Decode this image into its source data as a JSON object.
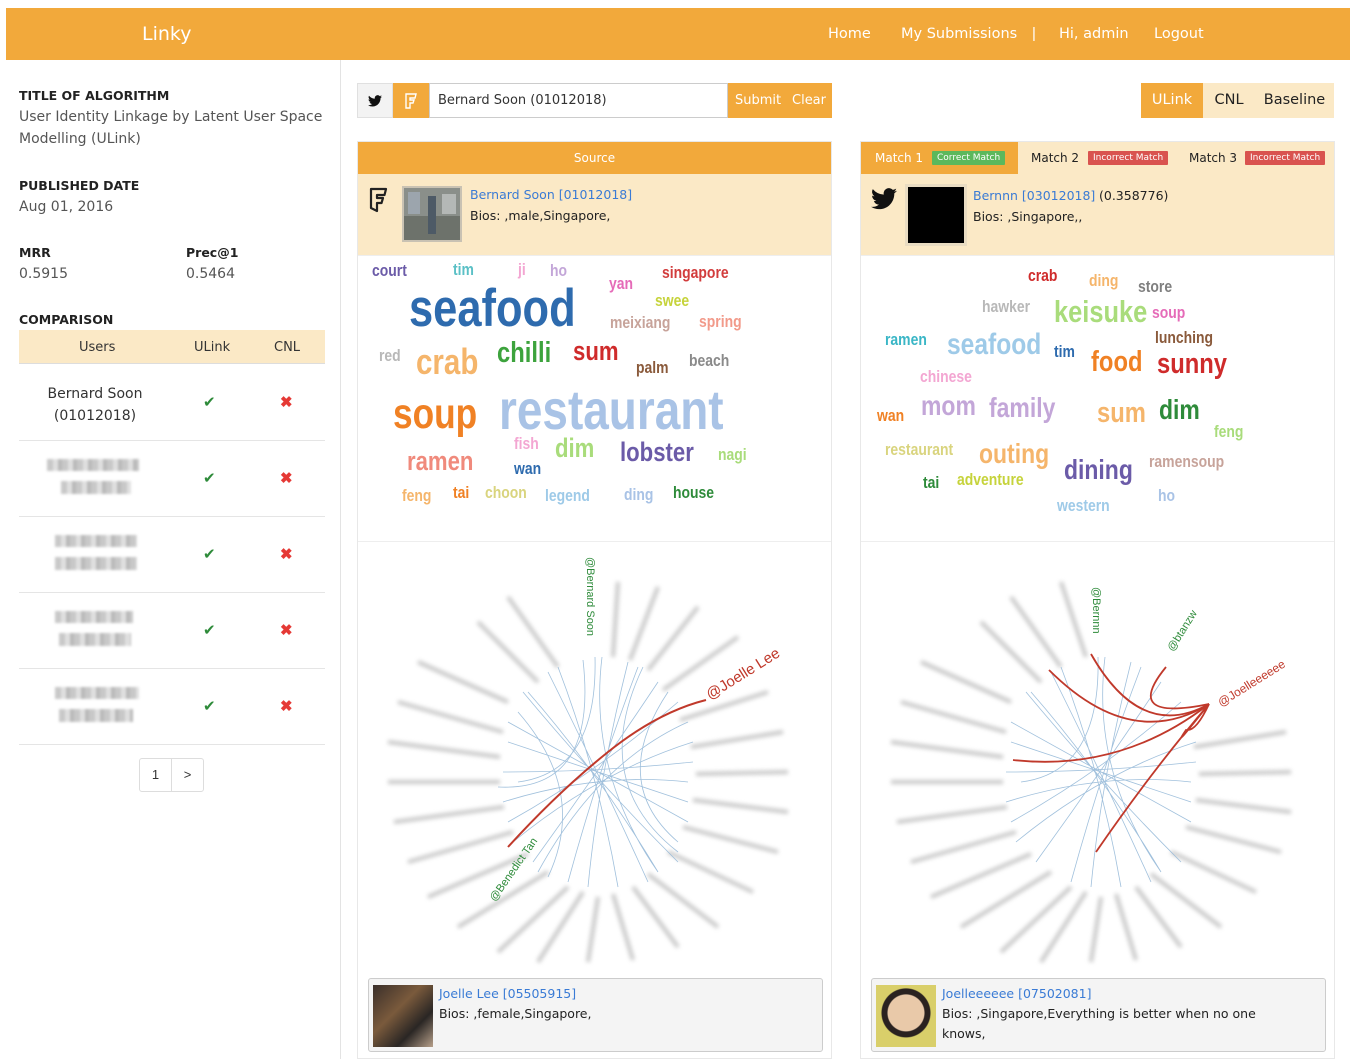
{
  "nav": {
    "brand": "Linky",
    "home": "Home",
    "submissions": "My Submissions",
    "separator": "|",
    "greeting": "Hi, admin",
    "logout": "Logout"
  },
  "sidebar": {
    "title_heading": "TITLE OF ALGORITHM",
    "title_line1": "User Identity Linkage by Latent User Space",
    "title_line2": "Modelling (ULink)",
    "date_heading": "PUBLISHED DATE",
    "date": "Aug 01, 2016",
    "mrr_heading": "MRR",
    "mrr": "0.5915",
    "prec_heading": "Prec@1",
    "prec": "0.5464",
    "comparison_heading": "COMPARISON",
    "table_headers": [
      "Users",
      "ULink",
      "CNL"
    ],
    "rows": [
      {
        "user_line1": "Bernard Soon",
        "user_line2": "(01012018)",
        "ulink": "✔",
        "cnl": "✖"
      },
      {
        "user_line1": "",
        "user_line2": "",
        "ulink": "✔",
        "cnl": "✖"
      },
      {
        "user_line1": "",
        "user_line2": "",
        "ulink": "✔",
        "cnl": "✖"
      },
      {
        "user_line1": "",
        "user_line2": "",
        "ulink": "✔",
        "cnl": "✖"
      },
      {
        "user_line1": "",
        "user_line2": "",
        "ulink": "✔",
        "cnl": "✖"
      }
    ],
    "pager": {
      "page": "1",
      "next": ">"
    }
  },
  "search": {
    "value": "Bernard Soon (01012018)",
    "submit": "Submit",
    "clear": "Clear",
    "icons": [
      "twitter-icon",
      "foursquare-icon"
    ]
  },
  "algo_tabs": [
    "ULink",
    "CNL",
    "Baseline"
  ],
  "source": {
    "header": "Source",
    "name": "Bernard Soon [01012018]",
    "bio": "Bios: ,male,Singapore,",
    "graph_labels": [
      "@Bernard Soon",
      "@Joelle Lee",
      "@Benedict Tan"
    ],
    "friend_name": "Joelle Lee [05505915]",
    "friend_bio": "Bios: ,female,Singapore,"
  },
  "match": {
    "tabs": [
      {
        "label": "Match 1",
        "badge": "Correct Match"
      },
      {
        "label": "Match 2",
        "badge": "Incorrect Match"
      },
      {
        "label": "Match 3",
        "badge": "Incorrect Match"
      }
    ],
    "name": "Bernnn [03012018]",
    "score": "(0.358776)",
    "bio": "Bios: ,Singapore,,",
    "graph_labels": [
      "@Bernnn",
      "@btanzw",
      "@Joelleeeeee"
    ],
    "friend_name": "Joelleeeeee [07502081]",
    "friend_bio_line1": "Bios: ,Singapore,Everything is better when no one",
    "friend_bio_line2": "knows,"
  },
  "colors": {
    "accent": "#F2A93B",
    "accent_light": "#FBE9C6",
    "link": "#3a7bd5",
    "correct": "#5cb85c",
    "incorrect": "#d9534f"
  }
}
